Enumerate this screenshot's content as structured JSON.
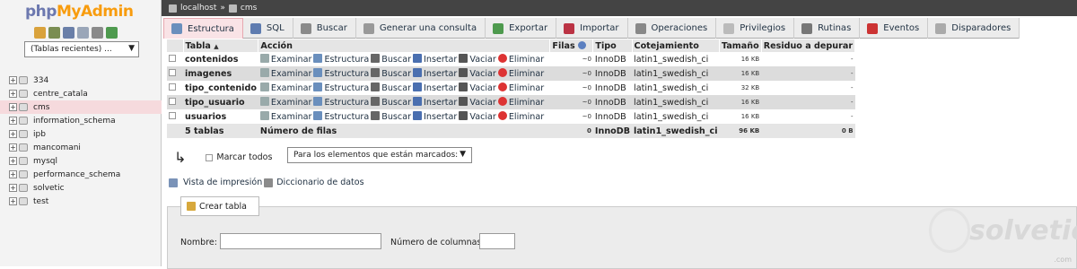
{
  "sidebar": {
    "logo_a": "php",
    "logo_b": "MyAdmin",
    "recent": "(Tablas recientes) ...",
    "dbs": [
      "334",
      "centre_catala",
      "cms",
      "information_schema",
      "ipb",
      "mancomani",
      "mysql",
      "performance_schema",
      "solvetic",
      "test"
    ]
  },
  "breadcrumb": {
    "server": "localhost",
    "sep": "»",
    "db": "cms"
  },
  "tabs": [
    "Estructura",
    "SQL",
    "Buscar",
    "Generar una consulta",
    "Exportar",
    "Importar",
    "Operaciones",
    "Privilegios",
    "Rutinas",
    "Eventos",
    "Disparadores"
  ],
  "table": {
    "headers": {
      "tabla": "Tabla",
      "sort": "▲",
      "accion": "Acción",
      "filas": "Filas",
      "tipo": "Tipo",
      "cotejamiento": "Cotejamiento",
      "tamano": "Tamaño",
      "residuo": "Residuo a depurar"
    },
    "actions": [
      "Examinar",
      "Estructura",
      "Buscar",
      "Insertar",
      "Vaciar",
      "Eliminar"
    ],
    "rows": [
      {
        "name": "contenidos",
        "filas": "~0",
        "tipo": "InnoDB",
        "cot": "latin1_swedish_ci",
        "size": "16 KB",
        "res": "-"
      },
      {
        "name": "imagenes",
        "filas": "~0",
        "tipo": "InnoDB",
        "cot": "latin1_swedish_ci",
        "size": "16 KB",
        "res": "-"
      },
      {
        "name": "tipo_contenido",
        "filas": "~0",
        "tipo": "InnoDB",
        "cot": "latin1_swedish_ci",
        "size": "32 KB",
        "res": "-"
      },
      {
        "name": "tipo_usuario",
        "filas": "~0",
        "tipo": "InnoDB",
        "cot": "latin1_swedish_ci",
        "size": "16 KB",
        "res": "-"
      },
      {
        "name": "usuarios",
        "filas": "~0",
        "tipo": "InnoDB",
        "cot": "latin1_swedish_ci",
        "size": "16 KB",
        "res": "-"
      }
    ],
    "footer": {
      "tables": "5 tablas",
      "label": "Número de filas",
      "filas": "0",
      "tipo": "InnoDB",
      "cot": "latin1_swedish_ci",
      "size": "96 KB",
      "res": "0 B"
    }
  },
  "bulk": {
    "mark_all": "Marcar todos",
    "with_selected": "Para los elementos que están marcados:"
  },
  "links": {
    "print": "Vista de impresión",
    "dict": "Diccionario de datos"
  },
  "create": {
    "tab": "Crear tabla",
    "name_label": "Nombre:",
    "cols_label": "Número de columnas:"
  },
  "watermark": {
    "brand": "solvetic",
    "sub": ".com"
  }
}
